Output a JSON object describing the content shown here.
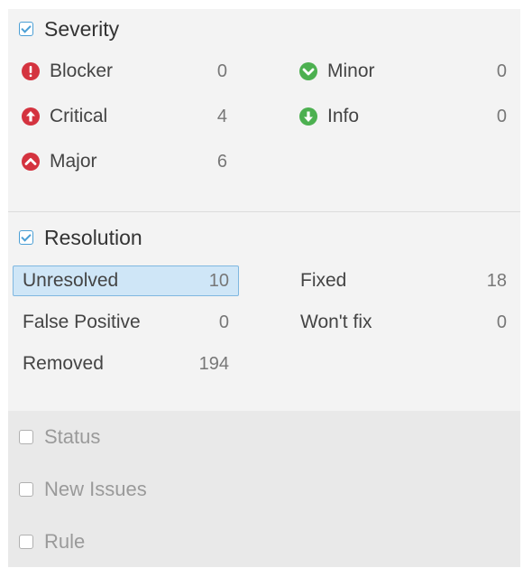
{
  "severity": {
    "title": "Severity",
    "checked": true,
    "items": [
      {
        "label": "Blocker",
        "count": "0",
        "icon": "blocker-icon",
        "color": "#d4333f"
      },
      {
        "label": "Critical",
        "count": "4",
        "icon": "critical-icon",
        "color": "#d4333f"
      },
      {
        "label": "Major",
        "count": "6",
        "icon": "major-icon",
        "color": "#d4333f"
      },
      {
        "label": "Minor",
        "count": "0",
        "icon": "minor-icon",
        "color": "#4cb050"
      },
      {
        "label": "Info",
        "count": "0",
        "icon": "info-icon",
        "color": "#4cb050"
      }
    ]
  },
  "resolution": {
    "title": "Resolution",
    "checked": true,
    "items": [
      {
        "label": "Unresolved",
        "count": "10",
        "selected": true
      },
      {
        "label": "False Positive",
        "count": "0"
      },
      {
        "label": "Removed",
        "count": "194"
      },
      {
        "label": "Fixed",
        "count": "18"
      },
      {
        "label": "Won't fix",
        "count": "0"
      }
    ]
  },
  "collapsed": [
    {
      "title": "Status"
    },
    {
      "title": "New Issues"
    },
    {
      "title": "Rule"
    }
  ],
  "colors": {
    "accent": "#4b9fd5",
    "selected_bg": "#cfe6f7",
    "red": "#d4333f",
    "green": "#4cb050"
  }
}
